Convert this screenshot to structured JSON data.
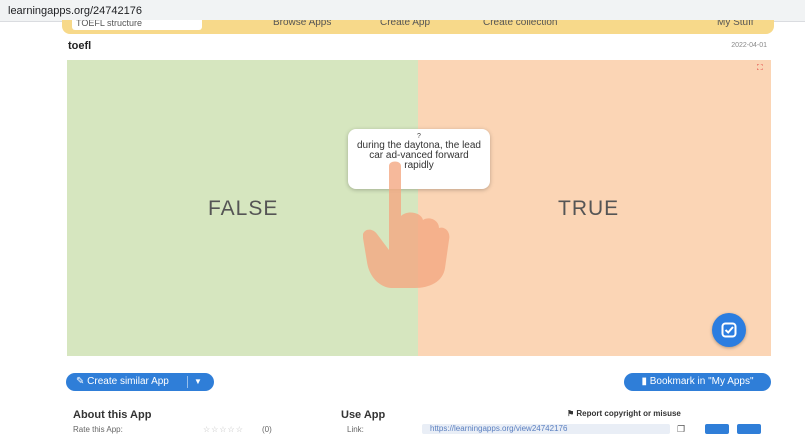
{
  "browser": {
    "url": "learningapps.org/24742176"
  },
  "topnav": {
    "search_value": "TOEFL structure",
    "browse": "Browse Apps",
    "create": "Create App",
    "collection": "Create collection",
    "mystuff": "My Stuff"
  },
  "app": {
    "title": "toefl",
    "date": "2022-04-01",
    "card_marker": "?",
    "card_text": "during the daytona, the lead car ad-vanced forward rapidly",
    "label_false": "FALSE",
    "label_true": "TRUE"
  },
  "actions": {
    "create_similar": "Create similar App",
    "bookmark": "Bookmark in \"My Apps\""
  },
  "about": {
    "title": "About this App",
    "rate_label": "Rate this App:",
    "stars": "☆☆☆☆☆",
    "rate_count": "(0)"
  },
  "use": {
    "title": "Use App",
    "report": "Report copyright or misuse",
    "link_label": "Link:",
    "link_value": "https://learningapps.org/view24742176"
  },
  "colors": {
    "false_bg": "#d6e6bf",
    "true_bg": "#fbd5b5",
    "accent_blue": "#2f7ed8",
    "nav_yellow": "#f7d98a"
  }
}
